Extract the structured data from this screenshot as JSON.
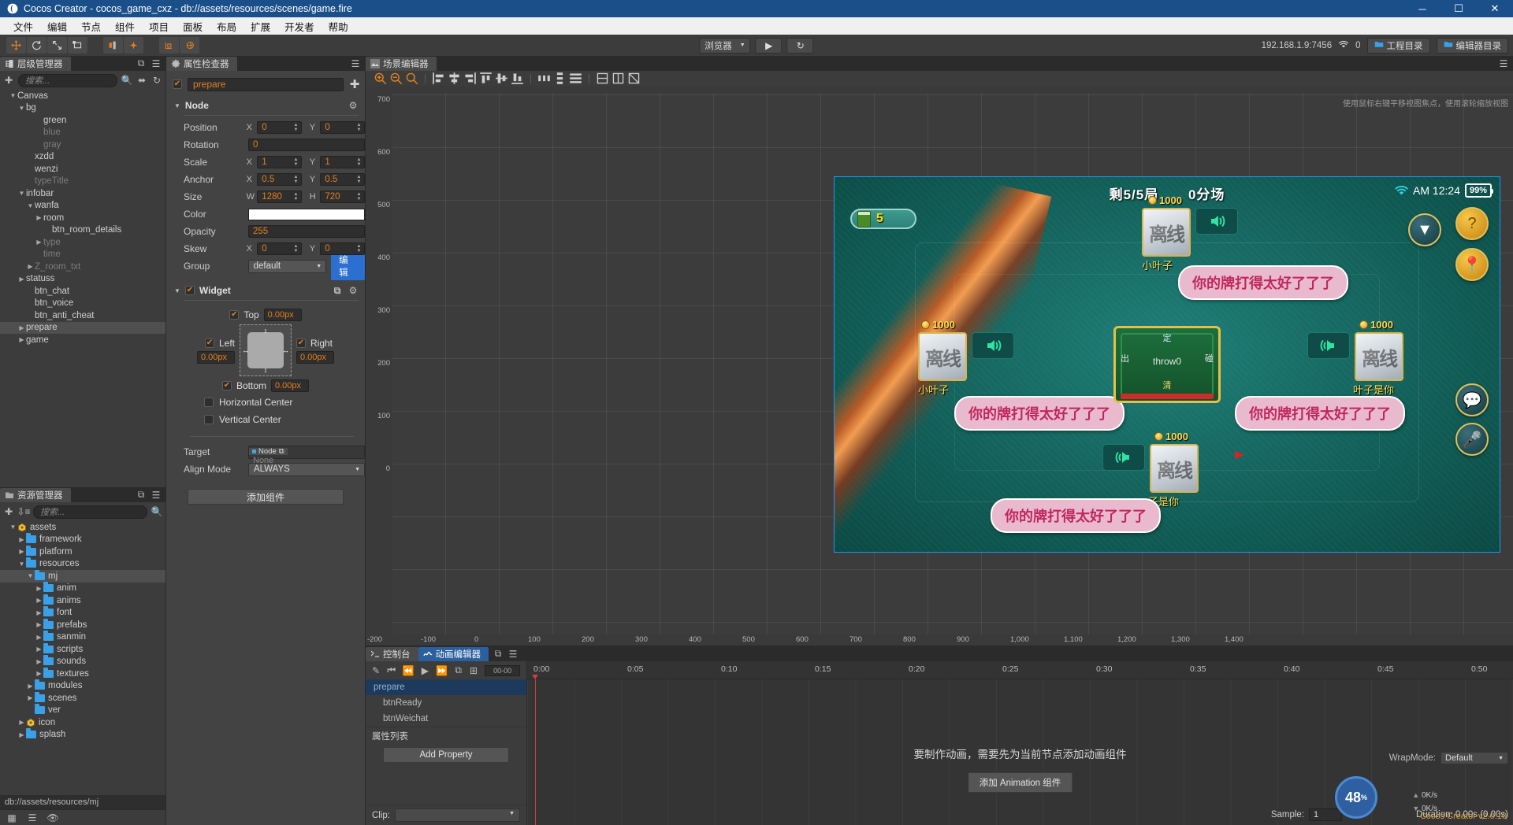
{
  "window": {
    "title": "Cocos Creator - cocos_game_cxz - db://assets/resources/scenes/game.fire",
    "minimize": "─",
    "maximize": "☐",
    "close": "✕"
  },
  "menubar": {
    "items": [
      "文件",
      "编辑",
      "节点",
      "组件",
      "项目",
      "面板",
      "布局",
      "扩展",
      "开发者",
      "帮助"
    ]
  },
  "toolbar": {
    "preview_target": "浏览器",
    "play": "▶",
    "refresh": "↻",
    "ip": "192.168.1.9:7456",
    "client_count": "0",
    "project_dir": "工程目录",
    "editor_dir": "编辑器目录"
  },
  "hierarchy": {
    "tab": "层级管理器",
    "search_placeholder": "搜索...",
    "nodes": [
      {
        "label": "Canvas",
        "indent": 1,
        "arrow": "open",
        "dim": false,
        "sel": false
      },
      {
        "label": "bg",
        "indent": 2,
        "arrow": "open",
        "dim": false,
        "sel": false
      },
      {
        "label": "green",
        "indent": 4,
        "arrow": "none",
        "dim": false,
        "sel": false
      },
      {
        "label": "blue",
        "indent": 4,
        "arrow": "none",
        "dim": true,
        "sel": false
      },
      {
        "label": "gray",
        "indent": 4,
        "arrow": "none",
        "dim": true,
        "sel": false
      },
      {
        "label": "xzdd",
        "indent": 3,
        "arrow": "none",
        "dim": false,
        "sel": false
      },
      {
        "label": "wenzi",
        "indent": 3,
        "arrow": "none",
        "dim": false,
        "sel": false
      },
      {
        "label": "typeTitle",
        "indent": 3,
        "arrow": "none",
        "dim": true,
        "sel": false
      },
      {
        "label": "infobar",
        "indent": 2,
        "arrow": "open",
        "dim": false,
        "sel": false
      },
      {
        "label": "wanfa",
        "indent": 3,
        "arrow": "open",
        "dim": false,
        "sel": false
      },
      {
        "label": "room",
        "indent": 4,
        "arrow": "closed",
        "dim": false,
        "sel": false
      },
      {
        "label": "btn_room_details",
        "indent": 5,
        "arrow": "none",
        "dim": false,
        "sel": false
      },
      {
        "label": "type",
        "indent": 4,
        "arrow": "closed",
        "dim": true,
        "sel": false
      },
      {
        "label": "time",
        "indent": 4,
        "arrow": "none",
        "dim": true,
        "sel": false
      },
      {
        "label": "Z_room_txt",
        "indent": 3,
        "arrow": "closed",
        "dim": true,
        "sel": false
      },
      {
        "label": "statuss",
        "indent": 2,
        "arrow": "closed",
        "dim": false,
        "sel": false
      },
      {
        "label": "btn_chat",
        "indent": 3,
        "arrow": "none",
        "dim": false,
        "sel": false
      },
      {
        "label": "btn_voice",
        "indent": 3,
        "arrow": "none",
        "dim": false,
        "sel": false
      },
      {
        "label": "btn_anti_cheat",
        "indent": 3,
        "arrow": "none",
        "dim": false,
        "sel": false
      },
      {
        "label": "prepare",
        "indent": 2,
        "arrow": "closed",
        "dim": false,
        "sel": true
      },
      {
        "label": "game",
        "indent": 2,
        "arrow": "closed",
        "dim": false,
        "sel": false
      }
    ]
  },
  "assets": {
    "tab": "资源管理器",
    "search_placeholder": "搜索...",
    "nodes": [
      {
        "label": "assets",
        "indent": 1,
        "arrow": "open",
        "icon": "gem",
        "sel": false
      },
      {
        "label": "framework",
        "indent": 2,
        "arrow": "closed",
        "icon": "folder",
        "sel": false
      },
      {
        "label": "platform",
        "indent": 2,
        "arrow": "closed",
        "icon": "folder",
        "sel": false
      },
      {
        "label": "resources",
        "indent": 2,
        "arrow": "open",
        "icon": "folder",
        "sel": false
      },
      {
        "label": "mj",
        "indent": 3,
        "arrow": "open",
        "icon": "folder",
        "sel": true
      },
      {
        "label": "anim",
        "indent": 4,
        "arrow": "closed",
        "icon": "folder",
        "sel": false
      },
      {
        "label": "anims",
        "indent": 4,
        "arrow": "closed",
        "icon": "folder",
        "sel": false
      },
      {
        "label": "font",
        "indent": 4,
        "arrow": "closed",
        "icon": "folder",
        "sel": false
      },
      {
        "label": "prefabs",
        "indent": 4,
        "arrow": "closed",
        "icon": "folder",
        "sel": false
      },
      {
        "label": "sanmin",
        "indent": 4,
        "arrow": "closed",
        "icon": "folder",
        "sel": false
      },
      {
        "label": "scripts",
        "indent": 4,
        "arrow": "closed",
        "icon": "folder",
        "sel": false
      },
      {
        "label": "sounds",
        "indent": 4,
        "arrow": "closed",
        "icon": "folder",
        "sel": false
      },
      {
        "label": "textures",
        "indent": 4,
        "arrow": "closed",
        "icon": "folder",
        "sel": false
      },
      {
        "label": "modules",
        "indent": 3,
        "arrow": "closed",
        "icon": "folder",
        "sel": false
      },
      {
        "label": "scenes",
        "indent": 3,
        "arrow": "closed",
        "icon": "folder",
        "sel": false
      },
      {
        "label": "ver",
        "indent": 3,
        "arrow": "none",
        "icon": "folder",
        "sel": false
      },
      {
        "label": "icon",
        "indent": 2,
        "arrow": "closed",
        "icon": "gem",
        "sel": false
      },
      {
        "label": "splash",
        "indent": 2,
        "arrow": "closed",
        "icon": "folder",
        "sel": false
      }
    ],
    "path": "db://assets/resources/mj"
  },
  "inspector": {
    "tab": "属性检查器",
    "node_name": "prepare",
    "node_enabled": true,
    "node_section": "Node",
    "properties": [
      {
        "label": "Position",
        "a1": "X",
        "v1": "0",
        "a2": "Y",
        "v2": "0",
        "type": "xy"
      },
      {
        "label": "Rotation",
        "a1": "",
        "v1": "0",
        "type": "single"
      },
      {
        "label": "Scale",
        "a1": "X",
        "v1": "1",
        "a2": "Y",
        "v2": "1",
        "type": "xy"
      },
      {
        "label": "Anchor",
        "a1": "X",
        "v1": "0.5",
        "a2": "Y",
        "v2": "0.5",
        "type": "xy"
      },
      {
        "label": "Size",
        "a1": "W",
        "v1": "1280",
        "a2": "H",
        "v2": "720",
        "type": "xy"
      },
      {
        "label": "Color",
        "v1": "#FFFFFF",
        "type": "color"
      },
      {
        "label": "Opacity",
        "v1": "255",
        "type": "single"
      },
      {
        "label": "Skew",
        "a1": "X",
        "v1": "0",
        "a2": "Y",
        "v2": "0",
        "type": "xy"
      },
      {
        "label": "Group",
        "v1": "default",
        "type": "group",
        "button": "编辑"
      }
    ],
    "widget": {
      "title": "Widget",
      "enabled": true,
      "top": {
        "label": "Top",
        "value": "0.00px",
        "on": true
      },
      "left": {
        "label": "Left",
        "value": "0.00px",
        "on": true
      },
      "right": {
        "label": "Right",
        "value": "0.00px",
        "on": true
      },
      "bottom": {
        "label": "Bottom",
        "value": "0.00px",
        "on": true
      },
      "horizontal_center": {
        "label": "Horizontal Center",
        "on": false
      },
      "vertical_center": {
        "label": "Vertical Center",
        "on": false
      },
      "target_label": "Target",
      "target_chip": "Node",
      "target_value": "None",
      "align_mode_label": "Align Mode",
      "align_mode_value": "ALWAYS"
    },
    "add_component": "添加组件"
  },
  "scene": {
    "tab": "场景编辑器",
    "hint": "使用鼠标右键平移视图焦点，使用滚轮缩放视图",
    "ruler_x": [
      "-200",
      "-100",
      "0",
      "100",
      "200",
      "300",
      "400",
      "500",
      "600",
      "700",
      "800",
      "900",
      "1,000",
      "1,100",
      "1,200",
      "1,300",
      "1,400"
    ],
    "ruler_y": [
      "700",
      "600",
      "500",
      "400",
      "300",
      "200",
      "100",
      "0"
    ]
  },
  "game": {
    "title_left": "剩5/5局",
    "title_right": "0分场",
    "card_count": "5",
    "status_time": "AM 12:24",
    "battery": "99%",
    "dealer": {
      "throw": "throw0",
      "left": "出",
      "right": "碰",
      "top": "定",
      "bottom": "清"
    },
    "seats": [
      {
        "id": "top",
        "coin": "1000",
        "nick": "小叶子",
        "offline": "离线",
        "bubble": "你的牌打得太好了了了"
      },
      {
        "id": "left",
        "coin": "1000",
        "nick": "小叶子",
        "offline": "离线",
        "bubble": "你的牌打得太好了了了"
      },
      {
        "id": "right",
        "coin": "1000",
        "nick": "叶子是你",
        "offline": "离线",
        "bubble": "你的牌打得太好了了了"
      },
      {
        "id": "bottom",
        "coin": "1000",
        "nick": "子是你",
        "offline": "离线",
        "bubble": "你的牌打得太好了了了"
      }
    ],
    "right_buttons": [
      "chevron-down",
      "question-mark",
      "location-pin",
      "chat",
      "microphone"
    ]
  },
  "bottom": {
    "tabs": [
      {
        "label": "控制台",
        "active": false,
        "icon": "console-icon"
      },
      {
        "label": "动画编辑器",
        "active": true,
        "icon": "animation-icon"
      }
    ],
    "time_display": "00-00",
    "rows": [
      {
        "label": "prepare",
        "selected": true
      },
      {
        "label": "btnReady",
        "selected": false
      },
      {
        "label": "btnWeichat",
        "selected": false
      }
    ],
    "property_list_label": "属性列表",
    "add_property": "Add Property",
    "clip_label": "Clip:",
    "clip_value": "",
    "timeline_labels": [
      "0:00",
      "0:05",
      "0:10",
      "0:15",
      "0:20",
      "0:25",
      "0:30",
      "0:35",
      "0:40",
      "0:45",
      "0:50"
    ],
    "center_message": "要制作动画，需要先为当前节点添加动画组件",
    "add_animation_component": "添加 Animation 组件",
    "wrapmode_label": "WrapMode:",
    "wrapmode_value": "Default",
    "sample_label": "Sample:",
    "sample_value": "1",
    "duration": "Duration: 0.00s (0.00s)"
  },
  "statusbar": {
    "progress": "48",
    "progress_unit": "%",
    "net_up": "0K/s",
    "net_down": "0K/s",
    "version": "Cocos Creator v2.0.10"
  },
  "colors": {
    "accent_orange": "#e08020",
    "accent_blue": "#2b6fd0",
    "title_blue": "#1b4f8a",
    "felt_green": "#126059"
  }
}
